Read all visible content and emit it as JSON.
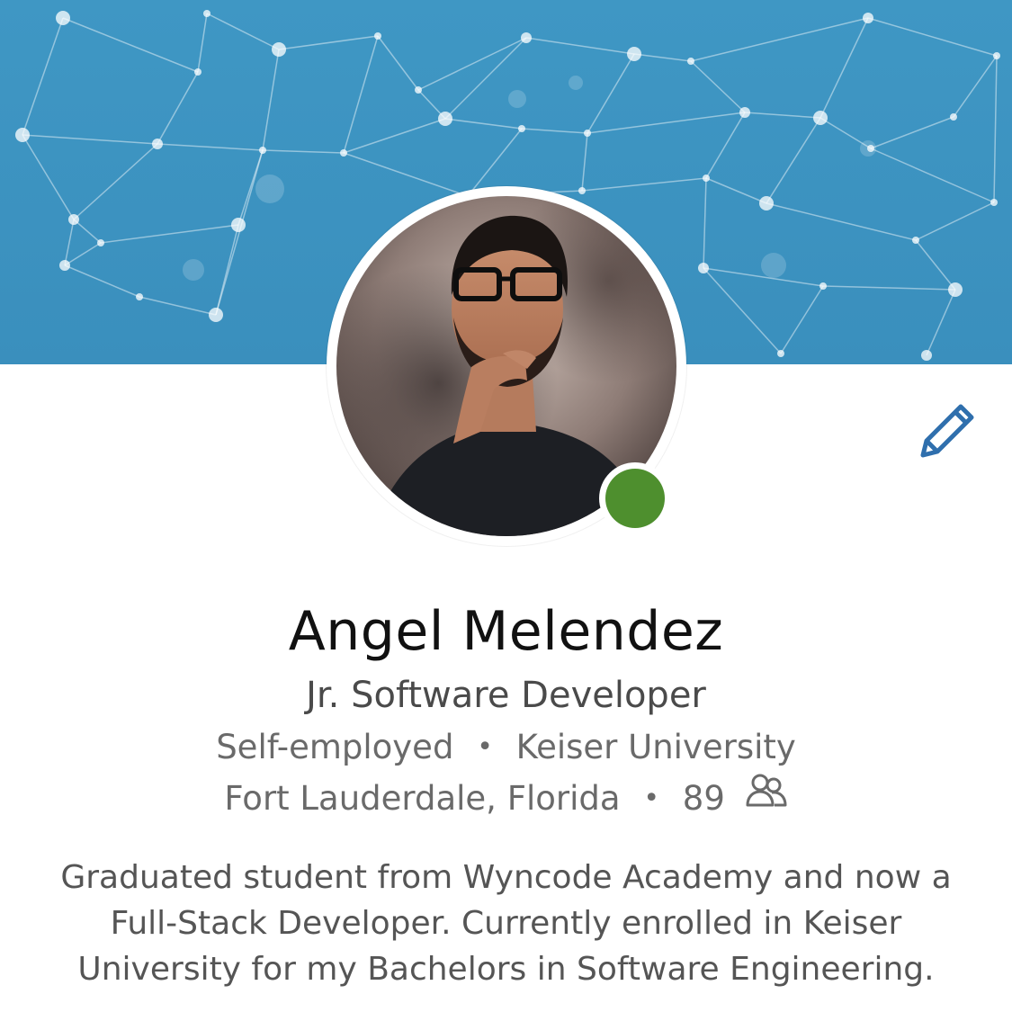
{
  "profile": {
    "name": "Angel Melendez",
    "headline": "Jr. Software Developer",
    "employer": "Self-employed",
    "school": "Keiser University",
    "location": "Fort Lauderdale, Florida",
    "connections": "89",
    "separator": "•",
    "summary": "Graduated student from Wyncode Academy and now a Full-Stack Developer. Currently enrolled in Keiser University for my Bachelors in Software Engineering."
  },
  "status": {
    "online": true,
    "color": "#4e8f2e"
  },
  "icons": {
    "edit": "pencil-icon",
    "connections": "people-icon"
  },
  "colors": {
    "banner": "#3f97c4",
    "accent": "#2f6fad"
  }
}
